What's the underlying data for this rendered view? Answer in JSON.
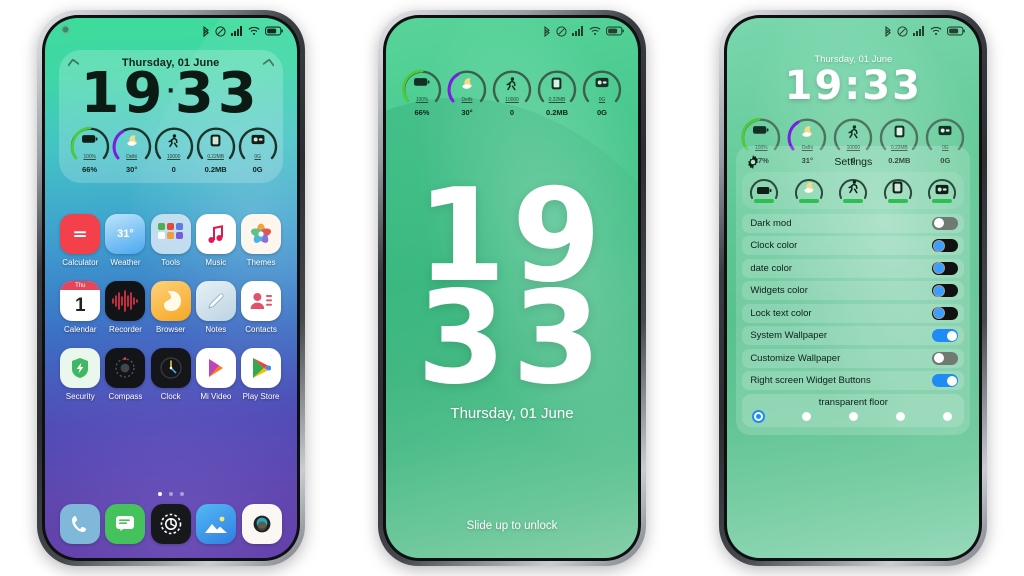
{
  "common": {
    "date": "Thursday, 01 June",
    "statusbar_icons": [
      "bluetooth-icon",
      "mute-icon",
      "signal-icon",
      "wifi-icon",
      "battery-icon"
    ],
    "widgets": [
      {
        "icon": "battery-icon",
        "max": "100%",
        "value": "66%"
      },
      {
        "icon": "weather-icon",
        "max": "Delhi",
        "value": "30°"
      },
      {
        "icon": "steps-icon",
        "max": "10000",
        "value": "0"
      },
      {
        "icon": "data-icon",
        "max": "0.22MB",
        "value": "0.2MB"
      },
      {
        "icon": "mobile-data-icon",
        "max": "0G",
        "value": "0G"
      }
    ]
  },
  "phone1": {
    "time": "1933",
    "hours": "19",
    "minutes": "33",
    "apps": [
      {
        "name": "Calculator",
        "icon": "calculator-icon"
      },
      {
        "name": "Weather",
        "icon": "weather-icon",
        "badge": "31°"
      },
      {
        "name": "Tools",
        "icon": "tools-folder-icon"
      },
      {
        "name": "Music",
        "icon": "music-note-icon"
      },
      {
        "name": "Themes",
        "icon": "themes-flower-icon"
      },
      {
        "name": "Calendar",
        "icon": "calendar-icon",
        "day": "1",
        "weekday": "Thu"
      },
      {
        "name": "Recorder",
        "icon": "recorder-waveform-icon"
      },
      {
        "name": "Browser",
        "icon": "browser-icon"
      },
      {
        "name": "Notes",
        "icon": "notes-pencil-icon"
      },
      {
        "name": "Contacts",
        "icon": "contacts-person-icon"
      },
      {
        "name": "Security",
        "icon": "security-shield-icon"
      },
      {
        "name": "Compass",
        "icon": "compass-icon"
      },
      {
        "name": "Clock",
        "icon": "clock-icon"
      },
      {
        "name": "Mi Video",
        "icon": "mi-video-play-icon"
      },
      {
        "name": "Play Store",
        "icon": "play-store-icon"
      }
    ],
    "dock": [
      {
        "name": "Phone",
        "icon": "phone-handset-icon"
      },
      {
        "name": "Messages",
        "icon": "messages-bubble-icon"
      },
      {
        "name": "Settings",
        "icon": "settings-gear-icon"
      },
      {
        "name": "Gallery",
        "icon": "gallery-photo-icon"
      },
      {
        "name": "Camera",
        "icon": "camera-lens-icon"
      }
    ],
    "page_dots": 3,
    "active_dot": 0
  },
  "phone2": {
    "hours": "19",
    "minutes": "33",
    "date": "Thursday, 01 June",
    "unlock_hint": "Slide up to unlock"
  },
  "phone3": {
    "date": "Thursday, 01 June",
    "time": "19:33",
    "widgets": [
      {
        "icon": "battery-icon",
        "max": "100%",
        "value": "67%"
      },
      {
        "icon": "weather-icon",
        "max": "Delhi",
        "value": "31°"
      },
      {
        "icon": "steps-icon",
        "max": "10000",
        "value": "0"
      },
      {
        "icon": "data-icon",
        "max": "0.22MB",
        "value": "0.2MB"
      },
      {
        "icon": "mobile-data-icon",
        "max": "0G",
        "value": "0G"
      }
    ],
    "settings_title": "Settings",
    "preview_icons": [
      "battery-icon",
      "weather-icon",
      "steps-icon",
      "data-icon",
      "mobile-data-icon"
    ],
    "rows": [
      {
        "label": "Dark mod",
        "state": "off"
      },
      {
        "label": "Clock color",
        "state": "half"
      },
      {
        "label": "date color",
        "state": "half"
      },
      {
        "label": "Widgets color",
        "state": "half"
      },
      {
        "label": "Lock text color",
        "state": "half"
      },
      {
        "label": "System Wallpaper",
        "state": "on"
      },
      {
        "label": "Customize Wallpaper",
        "state": "off"
      },
      {
        "label": "Right screen Widget Buttons",
        "state": "on"
      }
    ],
    "floor_title": "transparent floor",
    "floor_dots": 5,
    "floor_selected": 0
  },
  "colors": {
    "accent_blue": "#1f8cf5",
    "accent_green": "#2ec04f",
    "purple_ring": "#7a1fe0",
    "green_ring": "#4ecb3a"
  }
}
